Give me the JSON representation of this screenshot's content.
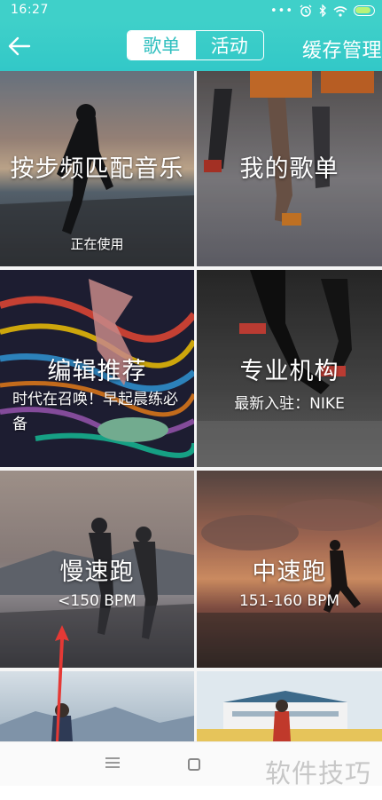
{
  "status_bar": {
    "time": "16:27",
    "dots": "•••",
    "icons": [
      "alarm-icon",
      "bluetooth-icon",
      "wifi-icon",
      "battery-charging-icon"
    ]
  },
  "header": {
    "back_icon": "arrow-left-icon",
    "tabs": [
      {
        "label": "歌单",
        "active": true
      },
      {
        "label": "活动",
        "active": false
      }
    ],
    "cache_label": "缓存管理",
    "accent": "#3fd0c9"
  },
  "cards": [
    {
      "title": "按步频匹配音乐",
      "subtitle": "正在使用"
    },
    {
      "title": "我的歌单",
      "subtitle": ""
    },
    {
      "title": "编辑推荐",
      "subtitle": "时代在召唤！早起晨练必备"
    },
    {
      "title": "专业机构",
      "subtitle": "最新入驻：NIKE"
    },
    {
      "title": "慢速跑",
      "subtitle": "<150 BPM"
    },
    {
      "title": "中速跑",
      "subtitle": "151-160 BPM"
    },
    {
      "title": "",
      "subtitle": ""
    },
    {
      "title": "",
      "subtitle": ""
    }
  ],
  "nav": {
    "menu_icon": "menu-icon",
    "home_icon": "square-home-icon"
  },
  "watermark": "软件技巧",
  "annotation": {
    "color": "#e53935",
    "icon": "red-arrow-up-icon"
  }
}
